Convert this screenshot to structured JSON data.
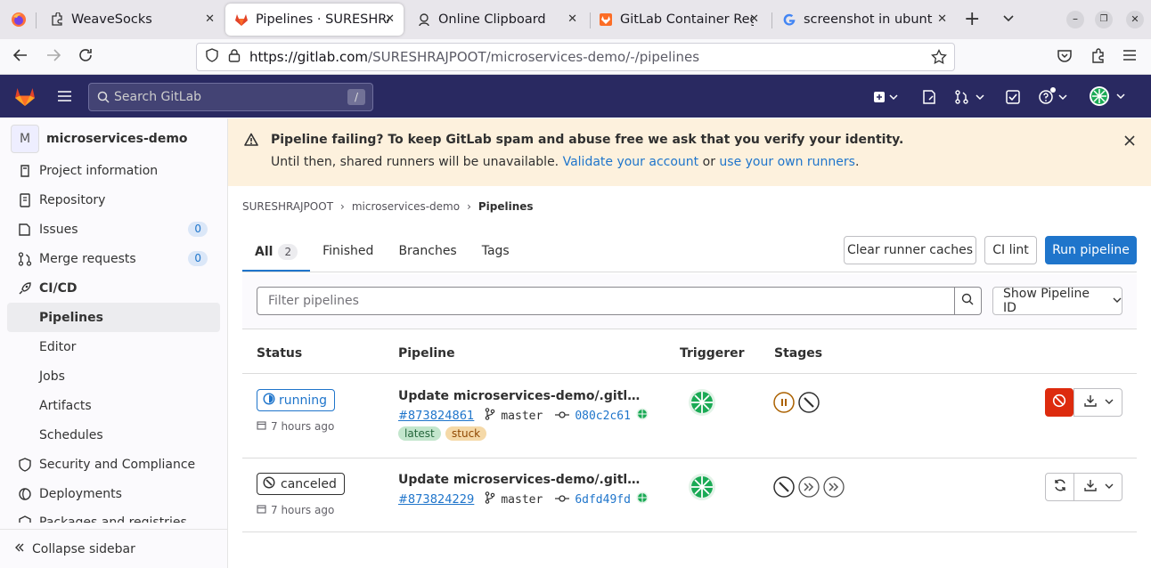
{
  "browser": {
    "tabs": [
      {
        "title": "WeaveSocks"
      },
      {
        "title": "Pipelines · SURESHRA…",
        "active": true
      },
      {
        "title": "Online Clipboard"
      },
      {
        "title": "GitLab Container Regi…"
      },
      {
        "title": "screenshot in ubuntu -"
      }
    ],
    "url_host": "https://gitlab.com",
    "url_path": "/SURESHRAJPOOT/microservices-demo/-/pipelines"
  },
  "top": {
    "search_placeholder": "Search GitLab",
    "search_shortcut": "/"
  },
  "sidebar": {
    "project_initial": "M",
    "project_name": "microservices-demo",
    "items": [
      {
        "label": "Project information"
      },
      {
        "label": "Repository"
      },
      {
        "label": "Issues",
        "count": "0"
      },
      {
        "label": "Merge requests",
        "count": "0"
      },
      {
        "label": "CI/CD"
      },
      {
        "label": "Pipelines"
      },
      {
        "label": "Editor"
      },
      {
        "label": "Jobs"
      },
      {
        "label": "Artifacts"
      },
      {
        "label": "Schedules"
      },
      {
        "label": "Security and Compliance"
      },
      {
        "label": "Deployments"
      },
      {
        "label": "Packages and registries"
      }
    ],
    "collapse_label": "Collapse sidebar"
  },
  "alert": {
    "title": "Pipeline failing? To keep GitLab spam and abuse free we ask that you verify your identity.",
    "body_prefix": "Until then, shared runners will be unavailable.",
    "link1": "Validate your account",
    "middle": "or",
    "link2": "use your own runners",
    "suffix": "."
  },
  "breadcrumb": {
    "owner": "SURESHRAJPOOT",
    "project": "microservices-demo",
    "current": "Pipelines"
  },
  "tabs": {
    "all": "All",
    "all_count": "2",
    "finished": "Finished",
    "branches": "Branches",
    "tags": "Tags"
  },
  "actions": {
    "clear_caches": "Clear runner caches",
    "ci_lint": "CI lint",
    "run_pipeline": "Run pipeline"
  },
  "filter": {
    "placeholder": "Filter pipelines",
    "show_id": "Show Pipeline ID"
  },
  "table": {
    "headers": {
      "status": "Status",
      "pipeline": "Pipeline",
      "triggerer": "Triggerer",
      "stages": "Stages"
    },
    "rows": [
      {
        "status": "running",
        "time": "7 hours ago",
        "title": "Update microservices-demo/.gitlab-ci.yml file",
        "id": "#873824861",
        "branch": "master",
        "sha": "080c2c61",
        "labels": [
          "latest",
          "stuck"
        ]
      },
      {
        "status": "canceled",
        "time": "7 hours ago",
        "title": "Update microservices-demo/.gitlab-ci.yml file",
        "id": "#873824229",
        "branch": "master",
        "sha": "6dfd49fd",
        "labels": []
      }
    ]
  },
  "colors": {
    "gitlab_nav": "#292961",
    "link": "#1f75cb",
    "alert_bg": "#fdf1dd",
    "danger": "#dd2b0e"
  }
}
